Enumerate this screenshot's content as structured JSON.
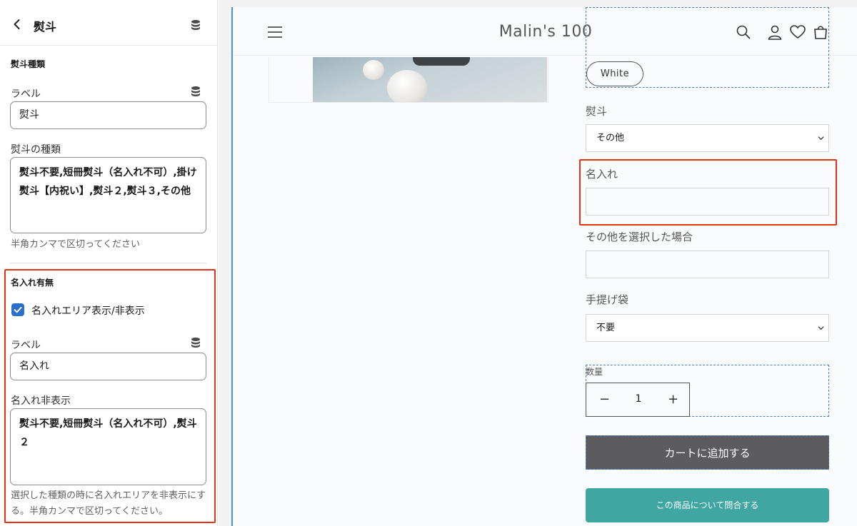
{
  "left_panel": {
    "title": "熨斗",
    "noshi_type_section": {
      "title": "熨斗種類",
      "label_field_label": "ラベル",
      "label_field_value": "熨斗",
      "types_field_label": "熨斗の種類",
      "types_field_value": "熨斗不要,短冊熨斗（名入れ不可）,掛け熨斗【内祝い】,熨斗２,熨斗３,その他",
      "types_help": "半角カンマで区切ってください"
    },
    "name_section": {
      "title": "名入れ有無",
      "checkbox_label": "名入れエリア表示/非表示",
      "checkbox_checked": true,
      "label_field_label": "ラベル",
      "label_field_value": "名入れ",
      "hide_field_label": "名入れ非表示",
      "hide_field_value": "熨斗不要,短冊熨斗（名入れ不可）,熨斗２",
      "hide_help": "選択した種類の時に名入れエリアを非表示にする。半角カンマで区切ってください。"
    }
  },
  "preview": {
    "store_name": "Malin's 100",
    "variant_pill": "White",
    "noshi_label": "熨斗",
    "noshi_selected": "その他",
    "name_label": "名入れ",
    "other_label": "その他を選択した場合",
    "bag_label": "手提げ袋",
    "bag_selected": "不要",
    "qty_label": "数量",
    "qty_minus": "−",
    "qty_value": "1",
    "qty_plus": "+",
    "cart_button": "カートに追加する",
    "inquiry_button": "この商品について問合する"
  },
  "colors": {
    "highlight": "#e0331a",
    "checkbox": "#2c6ecb",
    "cart_button": "#5c5c5e",
    "inquiry_button": "#3fa6a2",
    "selection_outline": "#4a7fc7"
  },
  "icons": [
    "chevron-left-icon",
    "database-icon",
    "menu-icon",
    "search-icon",
    "account-icon",
    "heart-icon",
    "cart-icon",
    "chevron-down-icon",
    "check-icon"
  ]
}
